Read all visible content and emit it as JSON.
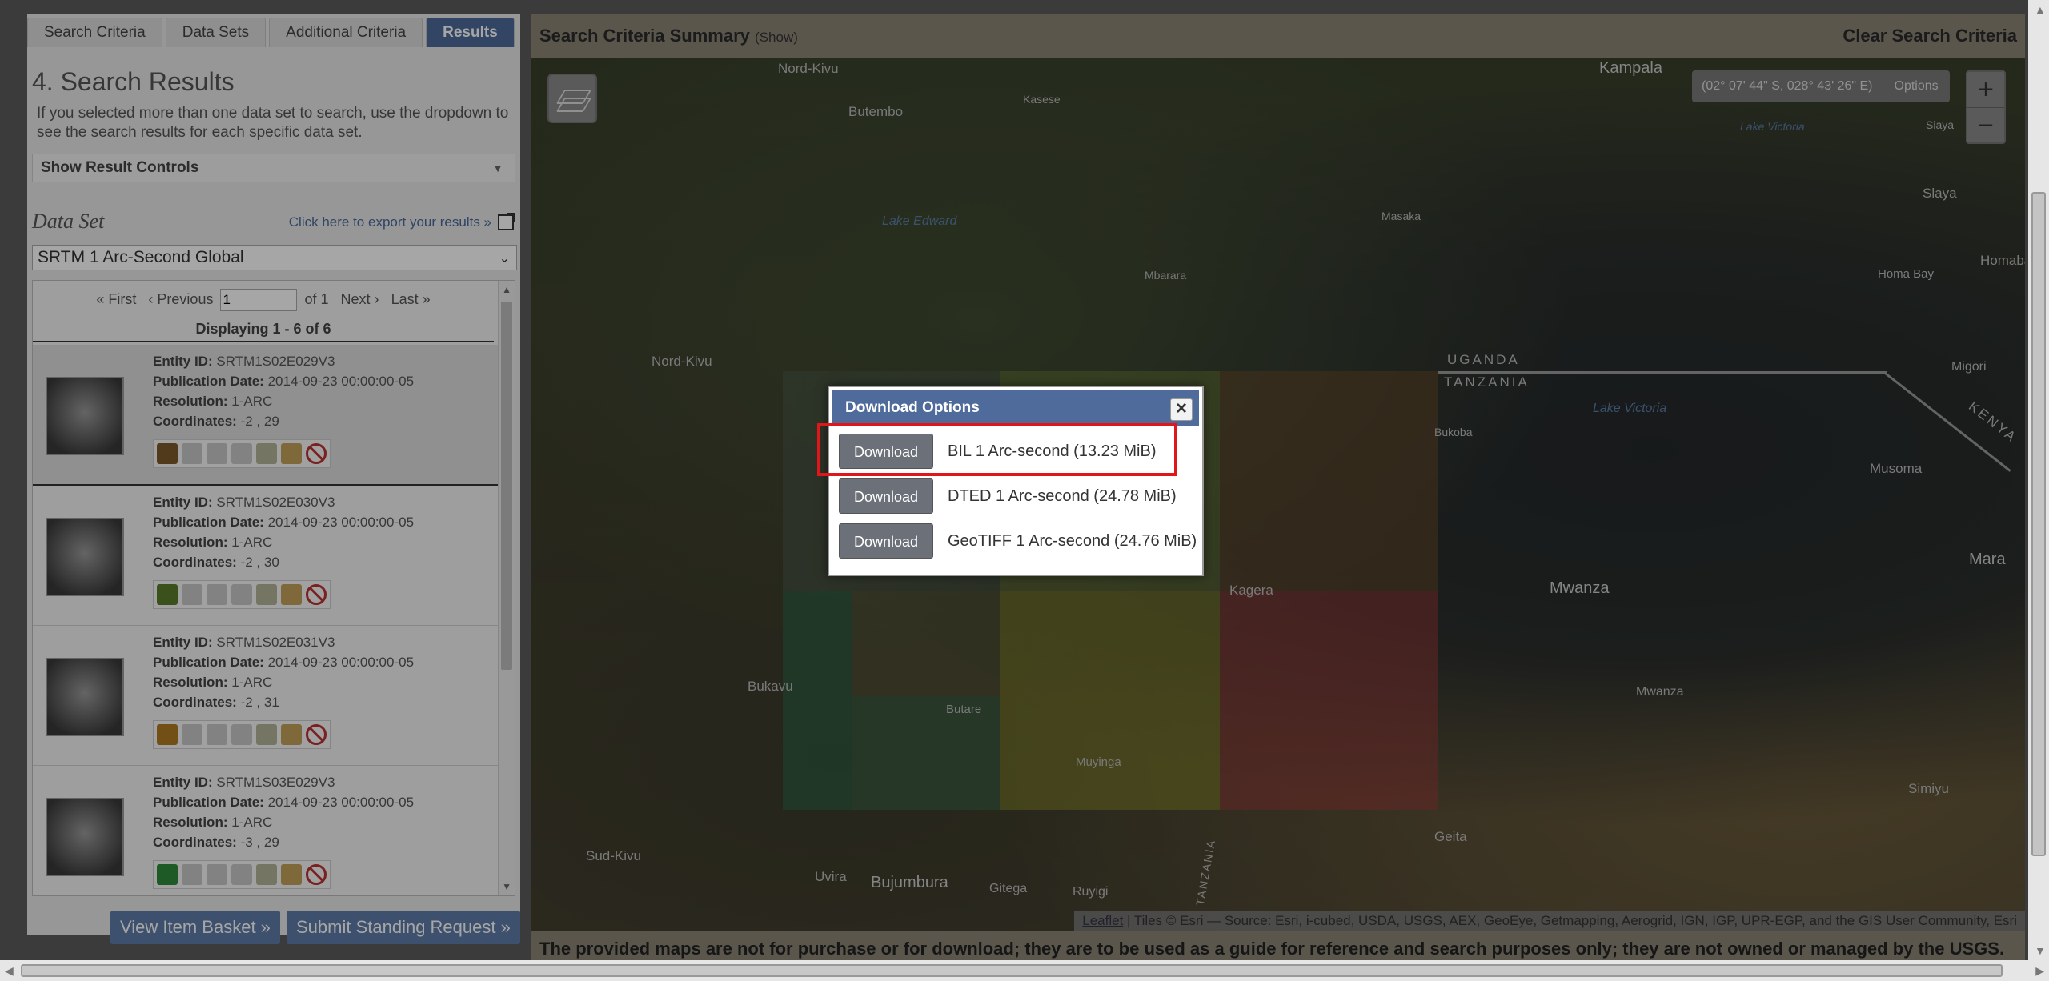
{
  "tabs": [
    "Search Criteria",
    "Data Sets",
    "Additional Criteria",
    "Results"
  ],
  "left": {
    "title": "4. Search Results",
    "helper": "If you selected more than one data set to search, use the dropdown to see the search results for each specific data set.",
    "result_controls": "Show Result Controls",
    "dataset_label": "Data Set",
    "export_link": "Click here to export your results »",
    "dataset_value": "SRTM 1 Arc-Second Global",
    "pager": {
      "first": "« First",
      "prev": "‹ Previous",
      "page": "1",
      "of": "of 1",
      "next": "Next ›",
      "last": "Last »"
    },
    "displaying": "Displaying 1 - 6 of 6",
    "labels": {
      "entity": "Entity ID:",
      "pub": "Publication Date:",
      "res": "Resolution:",
      "coords": "Coordinates:"
    },
    "items": [
      {
        "entity": "SRTM1S02E029V3",
        "pub": "2014-09-23 00:00:00-05",
        "res": "1-ARC",
        "coords": "-2 , 29"
      },
      {
        "entity": "SRTM1S02E030V3",
        "pub": "2014-09-23 00:00:00-05",
        "res": "1-ARC",
        "coords": "-2 , 30"
      },
      {
        "entity": "SRTM1S02E031V3",
        "pub": "2014-09-23 00:00:00-05",
        "res": "1-ARC",
        "coords": "-2 , 31"
      },
      {
        "entity": "SRTM1S03E029V3",
        "pub": "2014-09-23 00:00:00-05",
        "res": "1-ARC",
        "coords": "-3 , 29"
      }
    ],
    "buttons": {
      "basket": "View Item Basket »",
      "standing": "Submit Standing Request »"
    }
  },
  "map": {
    "header_title": "Search Criteria Summary",
    "header_show": "(Show)",
    "clear": "Clear Search Criteria",
    "coords": "(02° 07' 44\" S, 028° 43' 26\" E)",
    "options": "Options",
    "zoom_in": "+",
    "zoom_out": "−",
    "labels": {
      "nord_kivu_top": "Nord-Kivu",
      "kampala": "Kampala",
      "butembo": "Butembo",
      "kasese": "Kasese",
      "lake_victoria_top": "Lake Victoria",
      "siaya": "Siaya",
      "lake_edward": "Lake Edward",
      "masaka": "Masaka",
      "slaya": "Slaya",
      "mbarara": "Mbarara",
      "homa_bay_1": "Homa Bay",
      "homa_bay_2": "Homabay",
      "nord_kivu": "Nord-Kivu",
      "uganda": "UGANDA",
      "tanzania": "TANZANIA",
      "migori": "Migori",
      "bukoba": "Bukoba",
      "lake_victoria": "Lake Victoria",
      "kenya": "KENYA",
      "musoma": "Musoma",
      "mara": "Mara",
      "kagera": "Kagera",
      "mwanza_big": "Mwanza",
      "bukavu": "Bukavu",
      "mwanza": "Mwanza",
      "simiyu": "Simiyu",
      "butare": "Butare",
      "muyinga": "Muyinga",
      "sud_kivu": "Sud-Kivu",
      "geita": "Geita",
      "uvira": "Uvira",
      "bujumbura": "Bujumbura",
      "gitega": "Gitega",
      "ruyigi": "Ruyigi",
      "tanzania_v": "TANZANIA"
    },
    "attribution_link": "Leaflet",
    "attribution": " | Tiles © Esri — Source: Esri, i-cubed, USDA, USGS, AEX, GeoEye, Getmapping, Aerogrid, IGN, IGP, UPR-EGP, and the GIS User Community, Esri",
    "disclaimer": "The provided maps are not for purchase or for download; they are to be used as a guide for reference and search purposes only; they are not owned or managed by the USGS."
  },
  "modal": {
    "title": "Download Options",
    "close": "×",
    "options": [
      {
        "button": "Download",
        "label": "BIL 1 Arc-second (13.23 MiB)"
      },
      {
        "button": "Download",
        "label": "DTED 1 Arc-second (24.78 MiB)"
      },
      {
        "button": "Download",
        "label": "GeoTIFF 1 Arc-second (24.76 MiB)"
      }
    ]
  },
  "colors": {
    "accent": "#4f6b9b",
    "highlight": "#e0161b"
  }
}
